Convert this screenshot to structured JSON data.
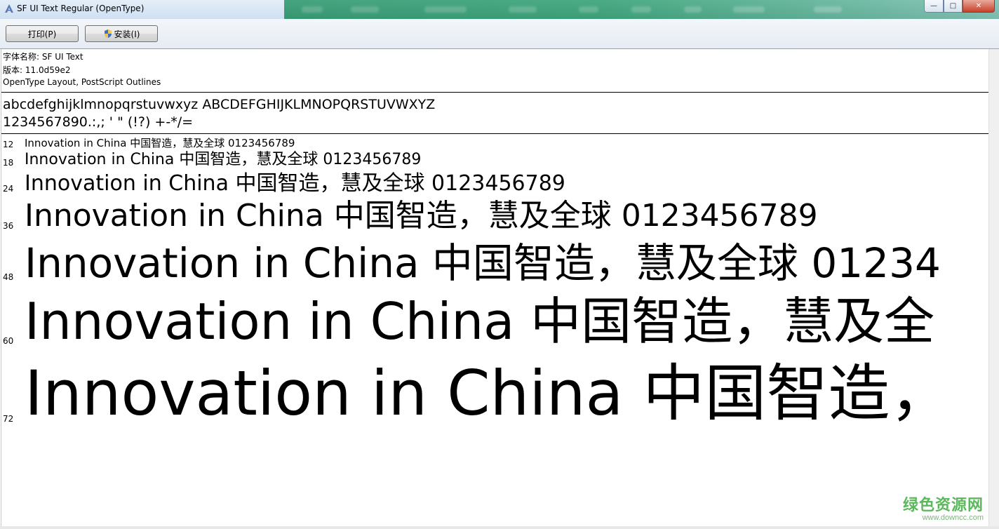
{
  "window": {
    "title": "SF UI Text Regular (OpenType)",
    "controls": {
      "minimize": "—",
      "maximize": "□",
      "close": "✕"
    }
  },
  "toolbar": {
    "print_label": "打印(P)",
    "install_label": "安装(I)"
  },
  "font_info": {
    "name_line": "字体名称: SF UI Text",
    "version_line": "版本: 11.0d59e2",
    "type_line": "OpenType Layout, PostScript Outlines"
  },
  "charset": {
    "letters": "abcdefghijklmnopqrstuvwxyz ABCDEFGHIJKLMNOPQRSTUVWXYZ",
    "digits_symbols": "1234567890.:,; ' \" (!?) +-*/="
  },
  "samples": [
    {
      "size": "12",
      "text": "Innovation in China 中国智造，慧及全球 0123456789"
    },
    {
      "size": "18",
      "text": "Innovation in China 中国智造，慧及全球 0123456789"
    },
    {
      "size": "24",
      "text": "Innovation in China 中国智造，慧及全球 0123456789"
    },
    {
      "size": "36",
      "text": "Innovation in China 中国智造，慧及全球 0123456789"
    },
    {
      "size": "48",
      "text": "Innovation in China 中国智造，慧及全球 01234"
    },
    {
      "size": "60",
      "text": "Innovation in China 中国智造，慧及全"
    },
    {
      "size": "72",
      "text": "Innovation in China 中国智造，"
    }
  ],
  "watermark": {
    "main": "绿色资源网",
    "sub": "www.downcc.com"
  },
  "colors": {
    "titlebar_accent": "#3aa07a",
    "watermark_green": "#5cb85c"
  }
}
